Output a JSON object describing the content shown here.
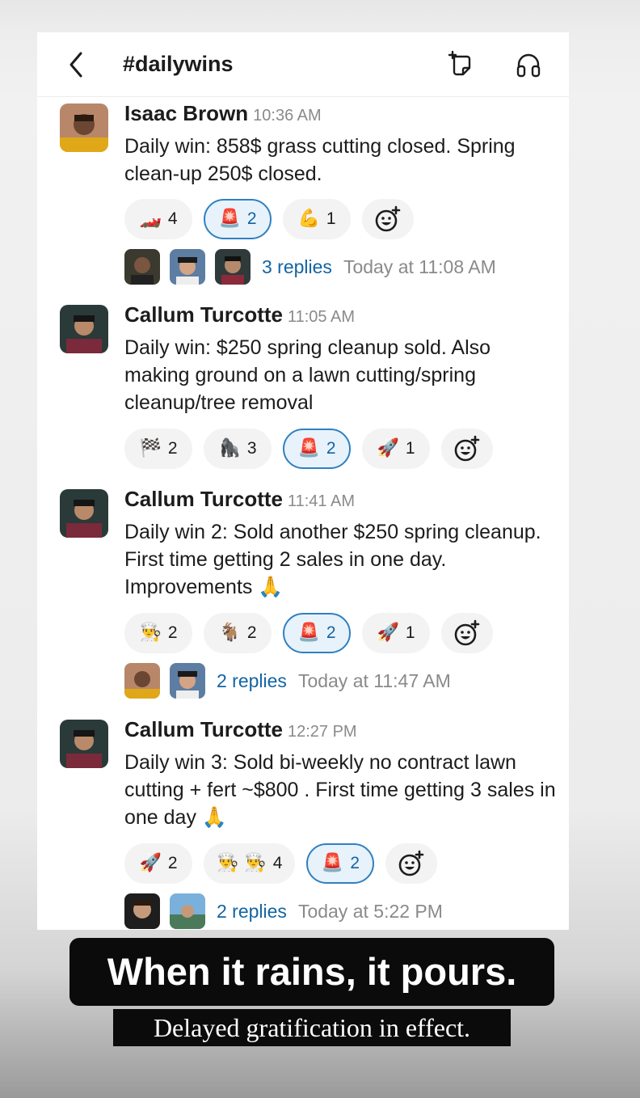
{
  "header": {
    "channel": "#dailywins"
  },
  "messages": [
    {
      "author": "Isaac Brown",
      "time": "10:36 AM",
      "text": "Daily win: 858$ grass cutting closed. Spring clean-up 250$ closed.",
      "reactions": [
        {
          "emoji": "🏎️",
          "count": "4",
          "selected": false
        },
        {
          "emoji": "🚨",
          "count": "2",
          "selected": true
        },
        {
          "emoji": "💪",
          "count": "1",
          "selected": false
        }
      ],
      "replies": {
        "link": "3 replies",
        "time": "Today at 11:08 AM"
      }
    },
    {
      "author": "Callum Turcotte",
      "time": "11:05 AM",
      "text": "Daily win: $250 spring cleanup sold. Also making ground on a lawn cutting/spring cleanup/tree removal",
      "reactions": [
        {
          "emoji": "🏁",
          "count": "2",
          "selected": false
        },
        {
          "emoji": "🦍",
          "count": "3",
          "selected": false
        },
        {
          "emoji": "🚨",
          "count": "2",
          "selected": true
        },
        {
          "emoji": "🚀",
          "count": "1",
          "selected": false
        }
      ]
    },
    {
      "author": "Callum Turcotte",
      "time": "11:41 AM",
      "text": "Daily win 2: Sold another $250 spring cleanup. First time getting 2 sales in one day. Improvements 🙏",
      "reactions": [
        {
          "emoji": "👨‍🍳",
          "count": "2",
          "selected": false
        },
        {
          "emoji": "🐐",
          "count": "2",
          "selected": false
        },
        {
          "emoji": "🚨",
          "count": "2",
          "selected": true
        },
        {
          "emoji": "🚀",
          "count": "1",
          "selected": false
        }
      ],
      "replies": {
        "link": "2 replies",
        "time": "Today at 11:47 AM"
      }
    },
    {
      "author": "Callum Turcotte",
      "time": "12:27 PM",
      "text": "Daily win 3: Sold bi-weekly no contract lawn cutting + fert ~$800 . First time getting 3 sales in one day 🙏",
      "reactions": [
        {
          "emoji": "🚀",
          "count": "2",
          "selected": false
        },
        {
          "emoji": "👨‍🍳 👨‍🍳",
          "count": "4",
          "selected": false
        },
        {
          "emoji": "🚨",
          "count": "2",
          "selected": true
        }
      ],
      "replies": {
        "link": "2 replies",
        "time": "Today at 5:22 PM"
      }
    }
  ],
  "captions": {
    "headline": "When it rains, it pours.",
    "subline": "Delayed gratification in effect."
  },
  "icons": [
    "back-chevron-icon",
    "canvas-add-icon",
    "huddle-headphones-icon",
    "add-reaction-icon"
  ]
}
